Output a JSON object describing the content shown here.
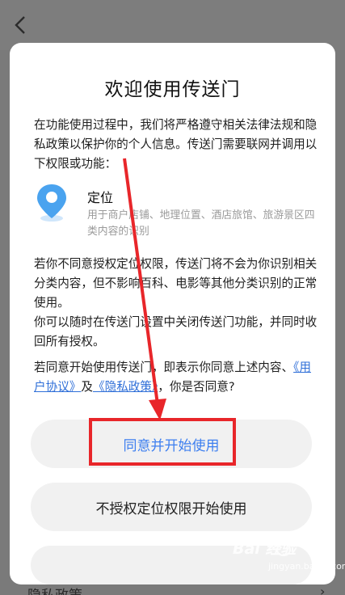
{
  "background": {
    "bottom_item_label": "隐私政策",
    "bottom_item_arrow": "›"
  },
  "dialog": {
    "title": "欢迎使用传送门",
    "intro": "在功能使用过程中，我们将严格遵守相关法律法规和隐私政策以保护你的个人信息。传送门需要联网并调用以下权限或功能：",
    "permission": {
      "icon": "location-pin-icon",
      "title": "定位",
      "description": "用于商户店铺、地理位置、酒店旅馆、旅游景区四类内容的识别"
    },
    "notice_1": "若你不同意授权定位权限，传送门将不会为你识别相关分类内容，但不影响百科、电影等其他分类识别的正常使用。",
    "notice_2": "你可以随时在传送门设置中关闭传送门功能，并同时收回所有授权。",
    "consent_prefix": "若同意开始使用传送门，即表示你同意上述内容、",
    "user_agreement_link": "《用户协议》",
    "consent_and": "及",
    "privacy_policy_link": "《隐私政策》",
    "consent_suffix": "，你是否同意?",
    "agree_button": "同意并开始使用",
    "no_location_button": "不授权定位权限开始使用"
  },
  "watermark": {
    "brand": "Bai  经验",
    "domain": "jingyan.baidu.com"
  },
  "colors": {
    "accent_link": "#2f6fd8",
    "agree_text": "#3d7ff0",
    "annotation_red": "#e8262a",
    "pin_blue": "#4aa3ef"
  }
}
